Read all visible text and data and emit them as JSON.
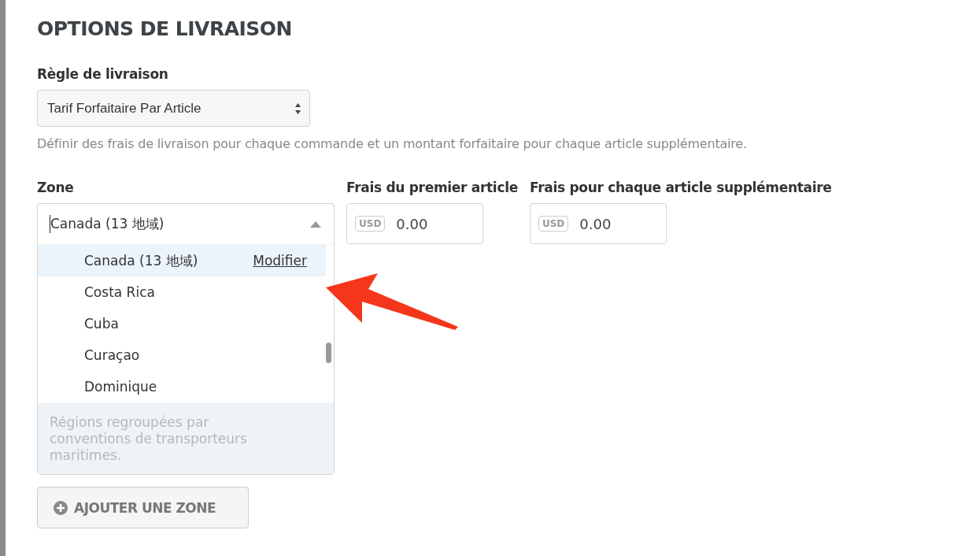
{
  "title": "OPTIONS DE LIVRAISON",
  "rule": {
    "label": "Règle de livraison",
    "value": "Tarif Forfaitaire Par Article",
    "help": "Définir des frais de livraison pour chaque commande et un montant forfaitaire pour chaque article supplémentaire."
  },
  "zone": {
    "label": "Zone",
    "value": "Canada (13 地域)",
    "expanded": true,
    "options": [
      {
        "label": "Canada (13 地域)",
        "selected": true,
        "action": "Modifier"
      },
      {
        "label": "Costa Rica",
        "selected": false
      },
      {
        "label": "Cuba",
        "selected": false
      },
      {
        "label": "Curaçao",
        "selected": false
      },
      {
        "label": "Dominique",
        "selected": false
      }
    ],
    "footer": "Régions regroupées par conventions de transporteurs maritimes."
  },
  "fees": [
    {
      "label": "Frais du premier article",
      "currency": "USD",
      "value": "0.00"
    },
    {
      "label": "Frais pour chaque article supplémentaire",
      "currency": "USD",
      "value": "0.00"
    }
  ],
  "add_button": "AJOUTER UNE ZONE"
}
